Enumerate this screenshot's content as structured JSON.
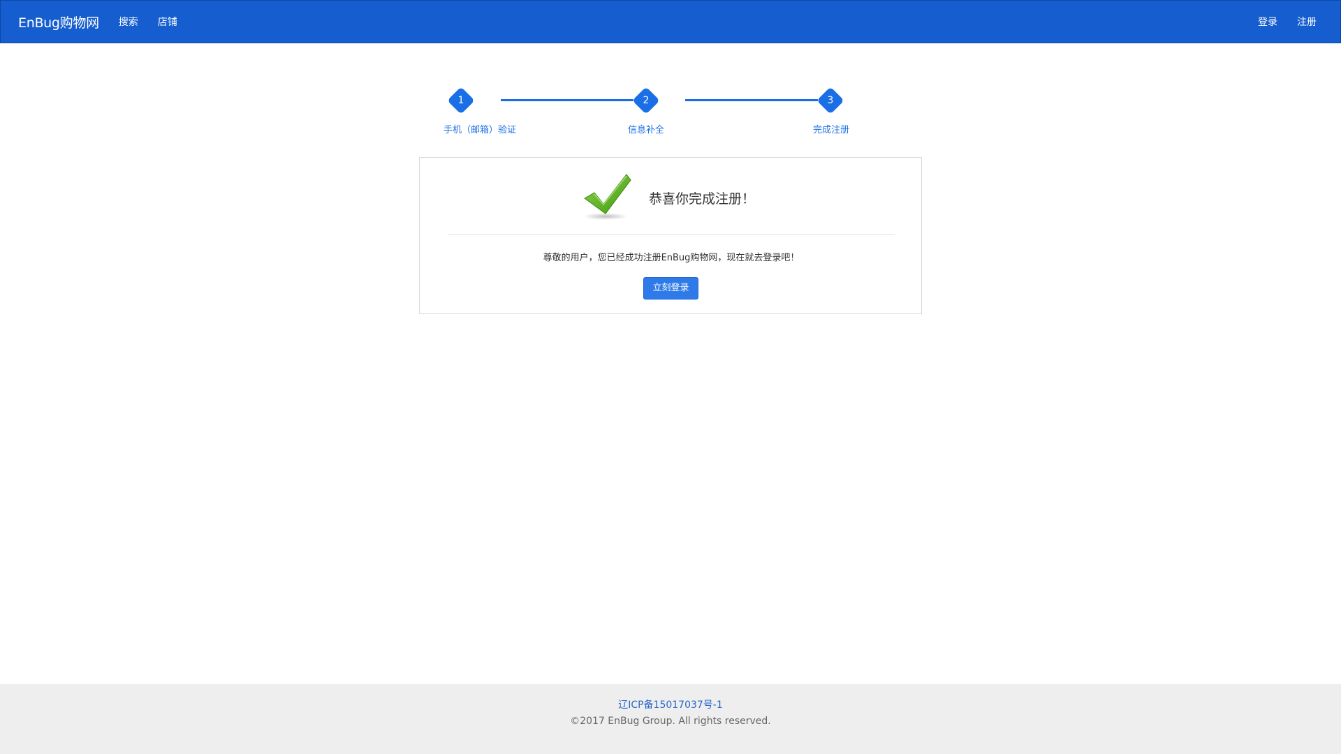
{
  "navbar": {
    "brand": "EnBug购物网",
    "links": [
      "搜索",
      "店铺"
    ],
    "right_links": [
      "登录",
      "注册"
    ],
    "bg_color": "#165ed0"
  },
  "steps": [
    {
      "number": "1",
      "label": "手机（邮箱）验证"
    },
    {
      "number": "2",
      "label": "信息补全"
    },
    {
      "number": "3",
      "label": "完成注册"
    }
  ],
  "card": {
    "icon": "checkmark-icon",
    "title": "恭喜你完成注册！",
    "message": "尊敬的用户，您已经成功注册EnBug购物网，现在就去登录吧！",
    "button_label": "立刻登录",
    "accent_color": "#1a6fe6"
  },
  "footer": {
    "icp": "辽ICP备15017037号-1",
    "copyright": "©2017 EnBug Group. All rights reserved."
  }
}
